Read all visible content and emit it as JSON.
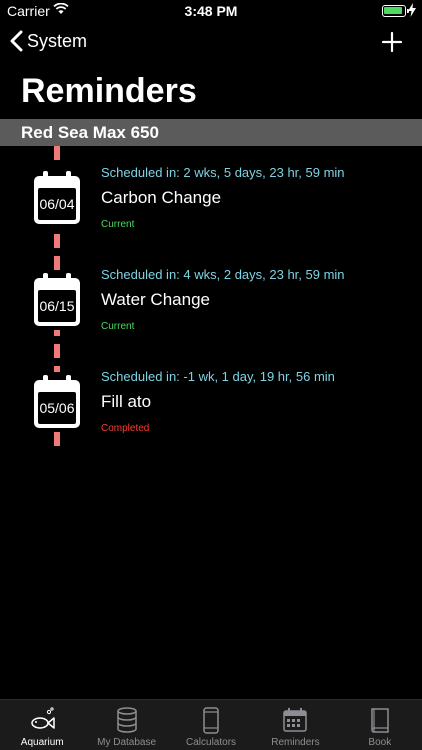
{
  "status_bar": {
    "carrier": "Carrier",
    "time": "3:48 PM"
  },
  "nav": {
    "back_label": "System"
  },
  "page_title": "Reminders",
  "section_title": "Red Sea Max 650",
  "colors": {
    "scheduled": "#7fd3e3",
    "current": "#4cd964",
    "completed": "#ff3b30",
    "timeline": "#f07a7a"
  },
  "reminders": [
    {
      "date": "06/04",
      "scheduled": "Scheduled in: 2 wks, 5 days, 23 hr, 59 min",
      "name": "Carbon Change",
      "status": "Current"
    },
    {
      "date": "06/15",
      "scheduled": "Scheduled in: 4 wks, 2 days, 23 hr, 59 min",
      "name": "Water Change",
      "status": "Current"
    },
    {
      "date": "05/06",
      "scheduled": "Scheduled in: -1 wk, 1 day, 19 hr, 56 min",
      "name": "Fill ato",
      "status": "Completed"
    }
  ],
  "tabs": [
    {
      "label": "Aquarium",
      "icon": "fish-icon",
      "active": true
    },
    {
      "label": "My Database",
      "icon": "database-icon",
      "active": false
    },
    {
      "label": "Calculators",
      "icon": "phone-icon",
      "active": false
    },
    {
      "label": "Reminders",
      "icon": "calendar-icon",
      "active": false
    },
    {
      "label": "Book",
      "icon": "book-icon",
      "active": false
    }
  ]
}
